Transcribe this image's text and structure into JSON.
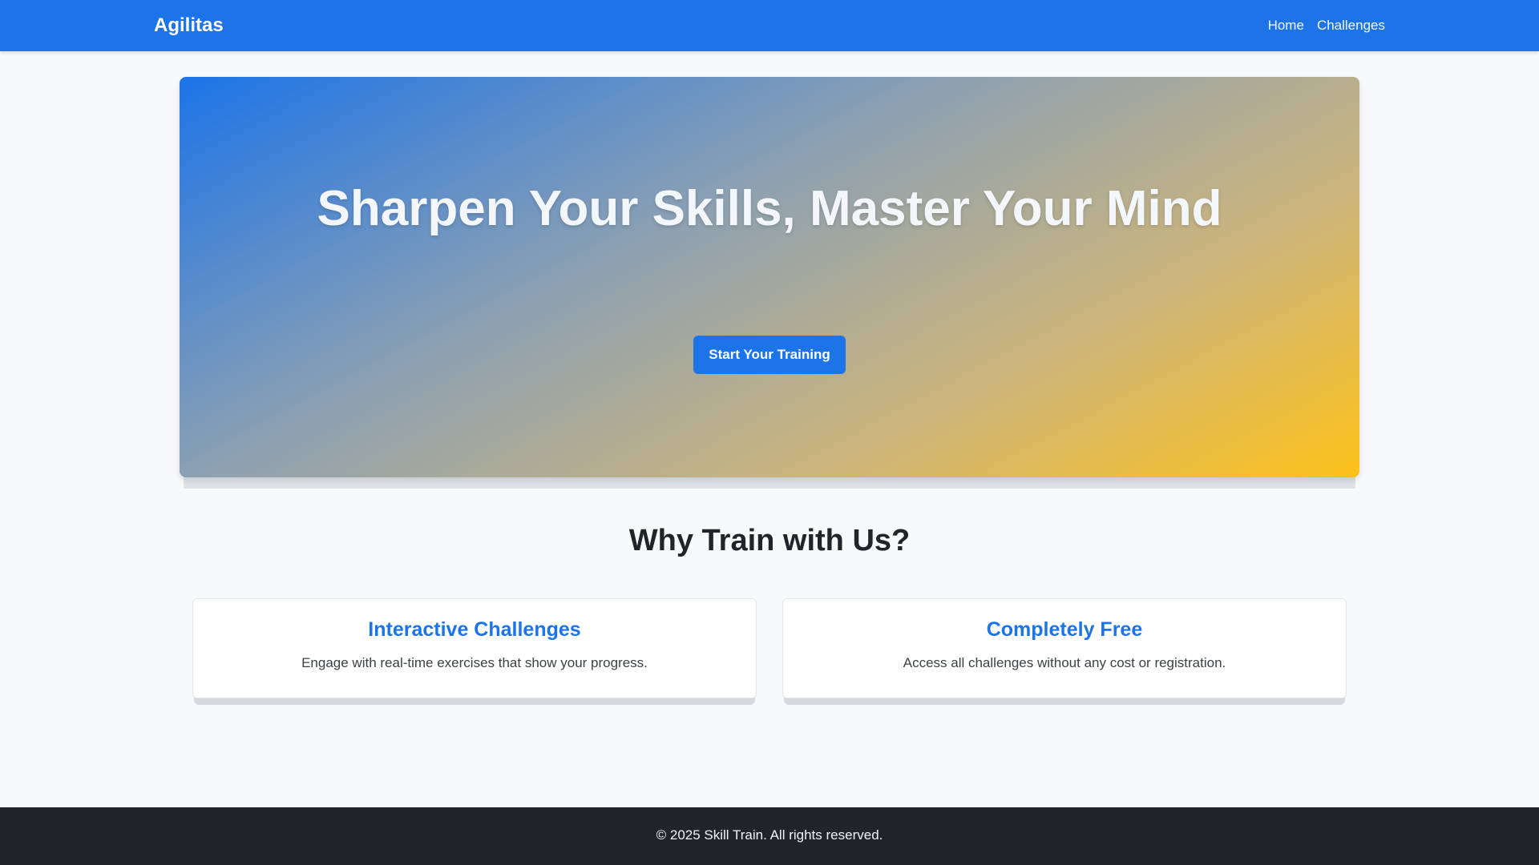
{
  "navbar": {
    "brand": "Agilitas",
    "links": [
      "Home",
      "Challenges"
    ]
  },
  "hero": {
    "title": "Sharpen Your Skills, Master Your Mind",
    "cta_label": "Start Your Training"
  },
  "features": {
    "title": "Why Train with Us?",
    "cards": [
      {
        "title": "Interactive Challenges",
        "text": "Engage with real-time exercises that show your progress."
      },
      {
        "title": "Completely Free",
        "text": "Access all challenges without any cost or registration."
      }
    ]
  },
  "footer": {
    "copyright": "© 2025 Skill Train. All rights reserved."
  },
  "colors": {
    "primary": "#1c74e8",
    "accent": "#fdc21a",
    "footer_bg": "#212429",
    "page_bg": "#f8f9fa"
  }
}
